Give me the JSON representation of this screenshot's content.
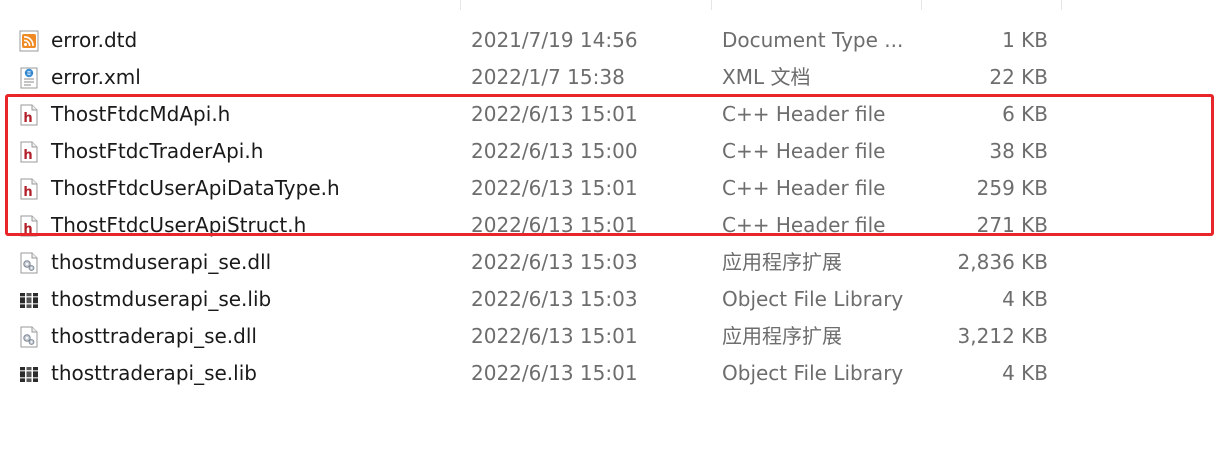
{
  "files": [
    {
      "name": "error.dtd",
      "date": "2021/7/19 14:56",
      "type": "Document Type ...",
      "size": "1 KB",
      "icon": "rss-icon"
    },
    {
      "name": "error.xml",
      "date": "2022/1/7 15:38",
      "type": "XML 文档",
      "size": "22 KB",
      "icon": "xml-file-icon"
    },
    {
      "name": "ThostFtdcMdApi.h",
      "date": "2022/6/13 15:01",
      "type": "C++ Header file",
      "size": "6 KB",
      "icon": "header-file-icon"
    },
    {
      "name": "ThostFtdcTraderApi.h",
      "date": "2022/6/13 15:00",
      "type": "C++ Header file",
      "size": "38 KB",
      "icon": "header-file-icon"
    },
    {
      "name": "ThostFtdcUserApiDataType.h",
      "date": "2022/6/13 15:01",
      "type": "C++ Header file",
      "size": "259 KB",
      "icon": "header-file-icon"
    },
    {
      "name": "ThostFtdcUserApiStruct.h",
      "date": "2022/6/13 15:01",
      "type": "C++ Header file",
      "size": "271 KB",
      "icon": "header-file-icon"
    },
    {
      "name": "thostmduserapi_se.dll",
      "date": "2022/6/13 15:03",
      "type": "应用程序扩展",
      "size": "2,836 KB",
      "icon": "dll-file-icon"
    },
    {
      "name": "thostmduserapi_se.lib",
      "date": "2022/6/13 15:03",
      "type": "Object File Library",
      "size": "4 KB",
      "icon": "lib-file-icon"
    },
    {
      "name": "thosttraderapi_se.dll",
      "date": "2022/6/13 15:01",
      "type": "应用程序扩展",
      "size": "3,212 KB",
      "icon": "dll-file-icon"
    },
    {
      "name": "thosttraderapi_se.lib",
      "date": "2022/6/13 15:01",
      "type": "Object File Library",
      "size": "4 KB",
      "icon": "lib-file-icon"
    }
  ],
  "colors": {
    "highlight": "#e8262a",
    "secondary_text": "#6d6d6d",
    "header_icon_red": "#b2202a",
    "rss_orange": "#f08a24"
  }
}
